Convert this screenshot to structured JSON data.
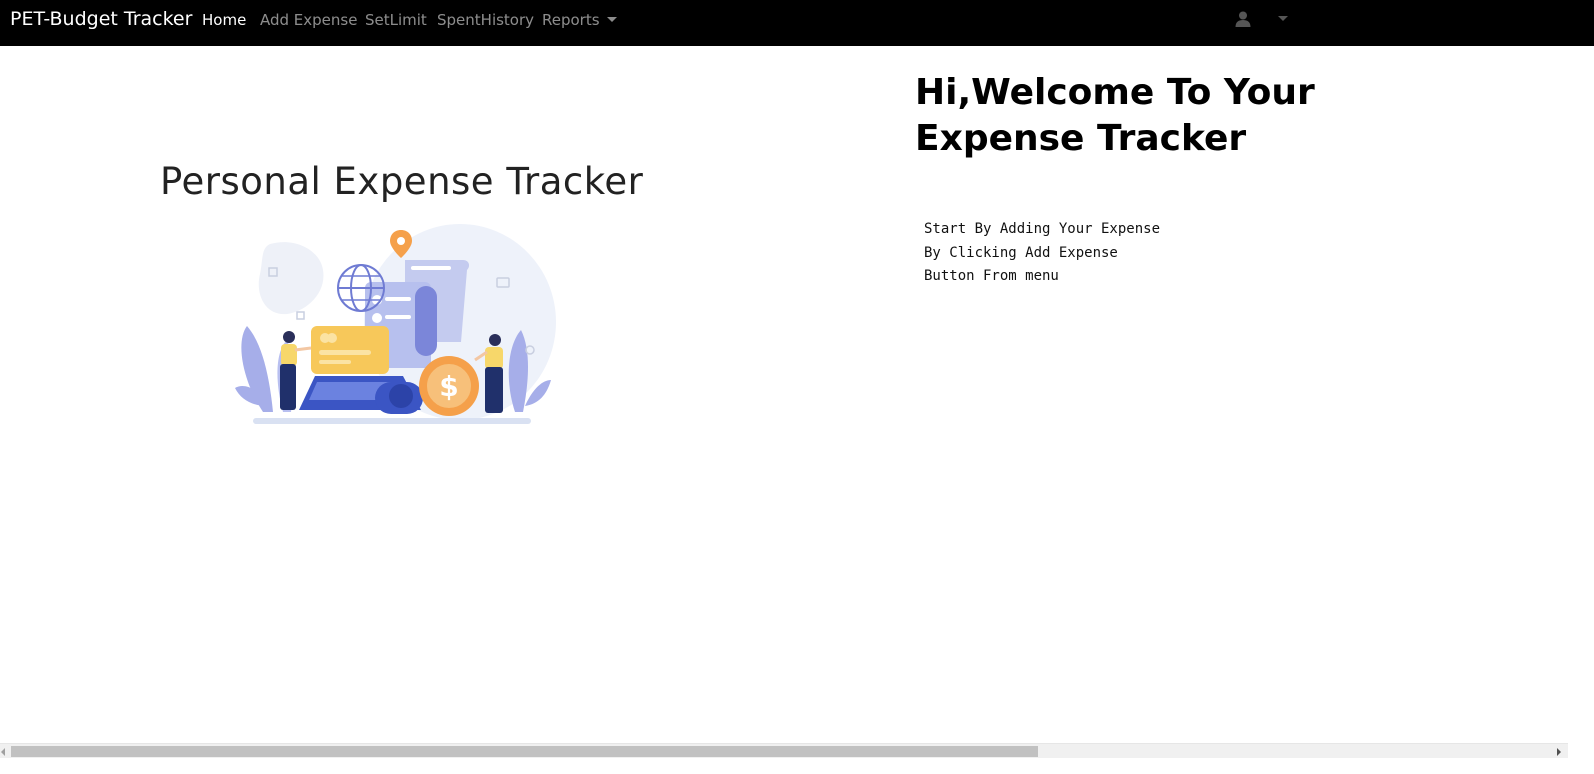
{
  "navbar": {
    "brand": "PET-Budget Tracker",
    "items": [
      {
        "label": "Home",
        "active": true
      },
      {
        "label": "Add Expense",
        "active": false
      },
      {
        "label": "SetLimit",
        "active": false
      },
      {
        "label": "SpentHistory",
        "active": false
      },
      {
        "label": "Reports",
        "active": false,
        "dropdown": true
      }
    ],
    "user_icon": "user-icon",
    "user_menu_icon": "caret-down-icon"
  },
  "main": {
    "left_title": "Personal Expense Tracker",
    "illustration_icon": "finance-payment-illustration",
    "welcome_heading": "Hi,Welcome To Your Expense Tracker",
    "instructions": "Start By Adding Your Expense\nBy Clicking Add Expense\nButton From menu"
  },
  "colors": {
    "navbar_bg": "#000000",
    "nav_active": "#ffffff",
    "nav_inactive": "#8c8c8c",
    "illustration_blue": "#7b86d9",
    "illustration_yellow": "#f7c85a",
    "illustration_orange": "#f5a04a"
  }
}
